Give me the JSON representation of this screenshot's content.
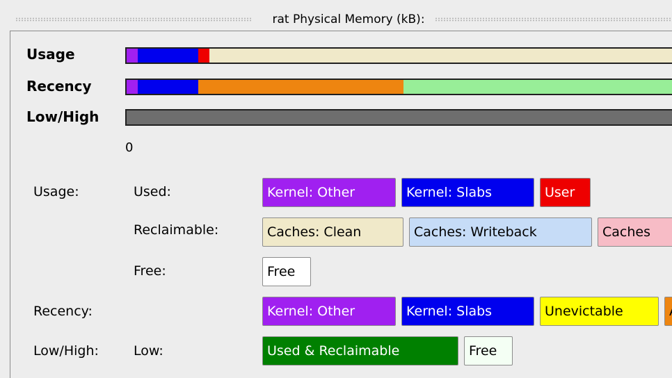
{
  "window": {
    "title": "rat Physical Memory (kB):"
  },
  "rows": {
    "usage": "Usage",
    "recency": "Recency",
    "lowhigh": "Low/High"
  },
  "bars": {
    "usage": [
      {
        "name": "kernel-other-segment",
        "color": "#a020f0",
        "fraction": 0.02
      },
      {
        "name": "kernel-slabs-segment",
        "color": "#0000ee",
        "fraction": 0.11
      },
      {
        "name": "user-segment",
        "color": "#ee0000",
        "fraction": 0.02
      },
      {
        "name": "caches-clean-segment",
        "color": "#f0e9c9",
        "fraction": 0.85
      }
    ],
    "recency": [
      {
        "name": "kernel-other-segment",
        "color": "#a020f0",
        "fraction": 0.02
      },
      {
        "name": "kernel-slabs-segment",
        "color": "#0000ee",
        "fraction": 0.11
      },
      {
        "name": "orange-segment",
        "color": "#ee8510",
        "fraction": 0.37
      },
      {
        "name": "green-segment",
        "color": "#98ee98",
        "fraction": 0.5
      }
    ],
    "lowhigh": [
      {
        "name": "gray-segment",
        "color": "#6e6e6e",
        "fraction": 1.0
      }
    ]
  },
  "axis_zero": "0",
  "legend": {
    "usage_label": "Usage:",
    "used_label": "Used:",
    "reclaimable_label": "Reclaimable:",
    "free_label": "Free:",
    "recency_label": "Recency:",
    "lowhigh_label": "Low/High:",
    "low_label": "Low:",
    "used_chips": [
      {
        "text": "Kernel: Other",
        "bg": "#a020f0",
        "fg": "#ffffff"
      },
      {
        "text": "Kernel: Slabs",
        "bg": "#0000ee",
        "fg": "#ffffff"
      },
      {
        "text": "User",
        "bg": "#ee0000",
        "fg": "#ffffff"
      }
    ],
    "reclaimable_chips": [
      {
        "text": "Caches: Clean",
        "bg": "#f0e9c9",
        "fg": "#000000"
      },
      {
        "text": "Caches: Writeback",
        "bg": "#c6dcf7",
        "fg": "#000000"
      },
      {
        "text": "Caches",
        "bg": "#f7bcc6",
        "fg": "#000000"
      }
    ],
    "free_chips": [
      {
        "text": "Free",
        "bg": "#ffffff",
        "fg": "#000000"
      }
    ],
    "recency_chips": [
      {
        "text": "Kernel: Other",
        "bg": "#a020f0",
        "fg": "#ffffff"
      },
      {
        "text": "Kernel: Slabs",
        "bg": "#0000ee",
        "fg": "#ffffff"
      },
      {
        "text": "Unevictable",
        "bg": "#ffff00",
        "fg": "#000000"
      },
      {
        "text": "A",
        "bg": "#ee8510",
        "fg": "#000000"
      }
    ],
    "low_chips": [
      {
        "text": "Used & Reclaimable",
        "bg": "#008000",
        "fg": "#ffffff"
      },
      {
        "text": "Free",
        "bg": "#f4fff4",
        "fg": "#000000"
      }
    ]
  }
}
